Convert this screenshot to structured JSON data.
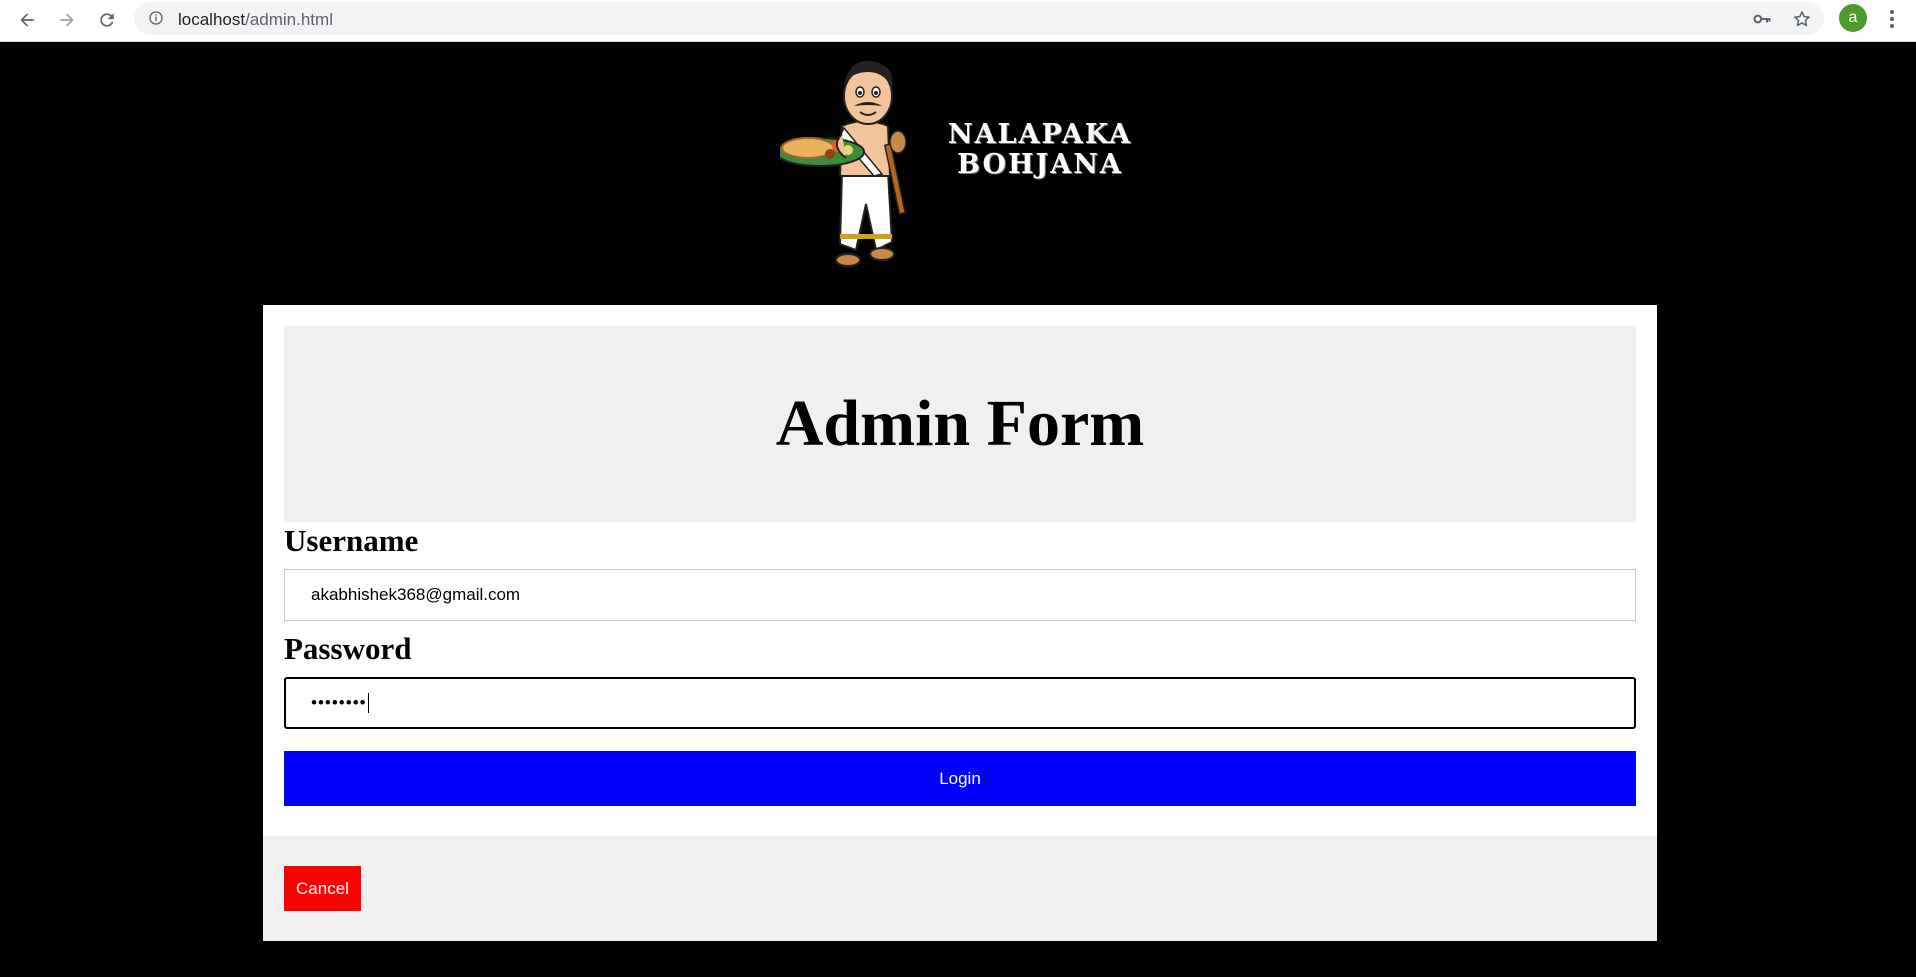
{
  "browser": {
    "url_host": "localhost",
    "url_path": "/admin.html",
    "profile_initial": "a"
  },
  "logo": {
    "line1": "NALAPAKA",
    "line2": "BOHJANA"
  },
  "form": {
    "title": "Admin Form",
    "username_label": "Username",
    "username_value": "akabhishek368@gmail.com",
    "password_label": "Password",
    "password_value": "••••••••",
    "login_label": "Login",
    "cancel_label": "Cancel"
  },
  "colors": {
    "page_background": "#000000",
    "login_button": "#0000ff",
    "cancel_button": "#ff0000",
    "header_box": "#f0f0f0"
  },
  "icons": [
    "back-icon",
    "forward-icon",
    "reload-icon",
    "info-icon",
    "key-icon",
    "star-icon",
    "menu-dots-icon",
    "chef-mascot-icon"
  ]
}
